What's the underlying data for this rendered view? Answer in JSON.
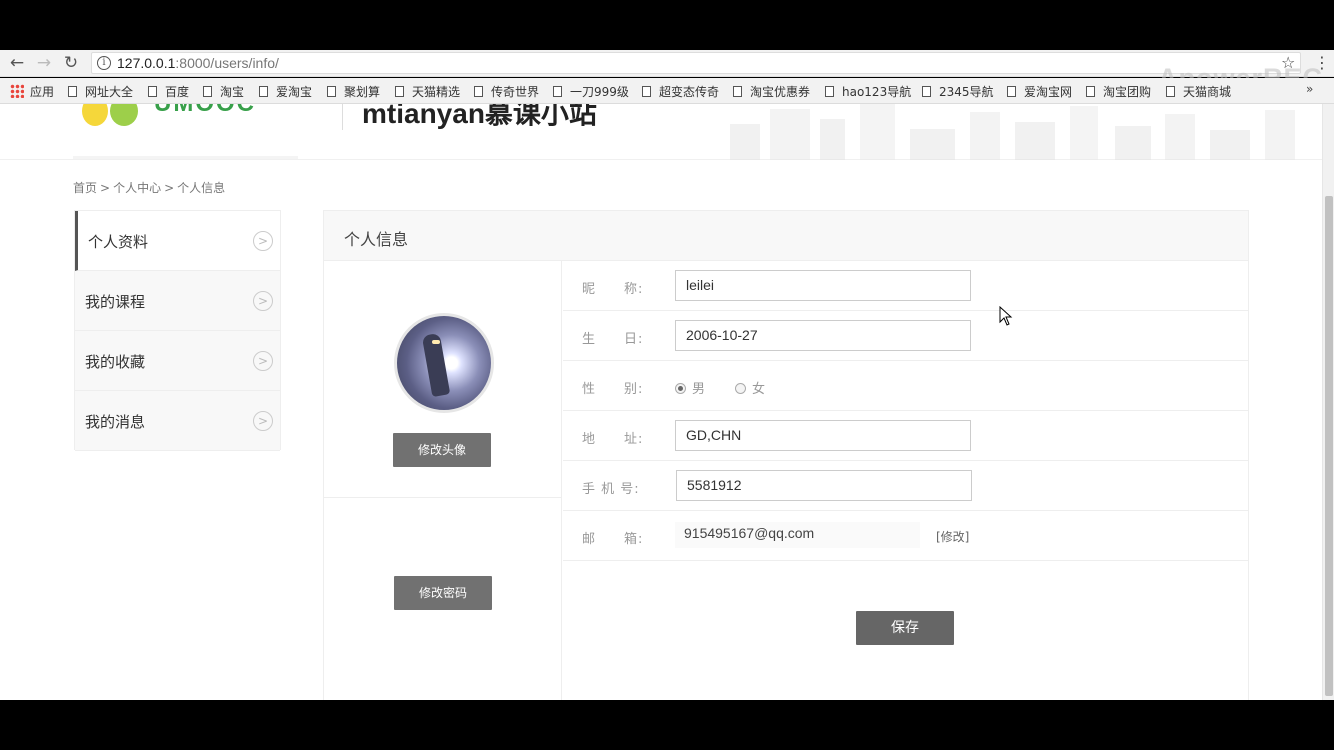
{
  "browser": {
    "url_host": "127.0.0.1",
    "url_rest": ":8000/users/info/",
    "bookmarks": [
      "应用",
      "网址大全",
      "百度",
      "淘宝",
      "爱淘宝",
      "聚划算",
      "天猫精选",
      "传奇世界",
      "一刀999级",
      "超变态传奇",
      "淘宝优惠券",
      "hao123导航",
      "2345导航",
      "爱淘宝网",
      "淘宝团购",
      "天猫商城"
    ],
    "more": "»",
    "watermark": "ApowerREC"
  },
  "header": {
    "logo_text": "UMOOC",
    "site_name": "mtianyan慕课小站"
  },
  "breadcrumb": [
    "首页",
    "个人中心",
    "个人信息"
  ],
  "sidebar": {
    "items": [
      {
        "label": "个人资料"
      },
      {
        "label": "我的课程"
      },
      {
        "label": "我的收藏"
      },
      {
        "label": "我的消息"
      }
    ]
  },
  "panel": {
    "title": "个人信息",
    "avatar_button": "修改头像",
    "password_button": "修改密码",
    "save_button": "保存"
  },
  "form": {
    "nickname_label": "昵　　称:",
    "nickname": "leilei",
    "birthday_label": "生　　日:",
    "birthday": "2006-10-27",
    "gender_label": "性　　别:",
    "gender_male": "男",
    "gender_female": "女",
    "address_label": "地　　址:",
    "address": "GD,CHN",
    "mobile_label": "手 机 号:",
    "mobile": "5581912",
    "email_label": "邮　　箱:",
    "email": "915495167@qq.com",
    "email_edit": "[修改]"
  },
  "colors": {
    "button": "#717171",
    "active_border": "#555555"
  }
}
